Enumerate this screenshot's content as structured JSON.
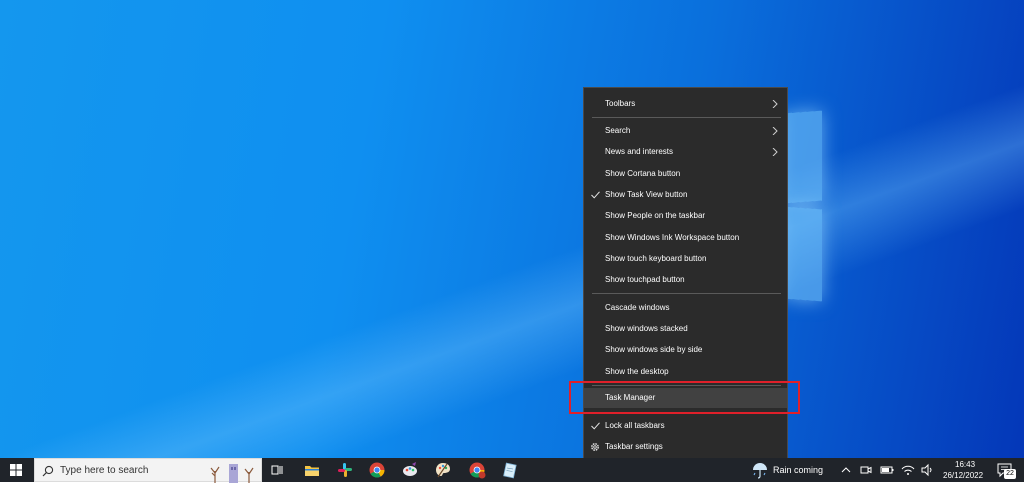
{
  "context_menu": {
    "toolbars": "Toolbars",
    "search": "Search",
    "news_and_interests": "News and interests",
    "show_cortana": "Show Cortana button",
    "show_task_view": "Show Task View button",
    "show_people": "Show People on the taskbar",
    "show_ink_workspace": "Show Windows Ink Workspace button",
    "show_touch_keyboard": "Show touch keyboard button",
    "show_touchpad": "Show touchpad button",
    "cascade": "Cascade windows",
    "stacked": "Show windows stacked",
    "side_by_side": "Show windows side by side",
    "show_desktop": "Show the desktop",
    "task_manager": "Task Manager",
    "lock_taskbars": "Lock all taskbars",
    "taskbar_settings": "Taskbar settings"
  },
  "taskbar": {
    "search_placeholder": "Type here to search",
    "weather": "Rain coming",
    "time": "16:43",
    "date": "26/12/2022",
    "notification_count": "22"
  },
  "colors": {
    "highlight_border": "#e0202a",
    "menu_bg": "#2b2b2b",
    "taskbar_bg": "#20242a"
  }
}
